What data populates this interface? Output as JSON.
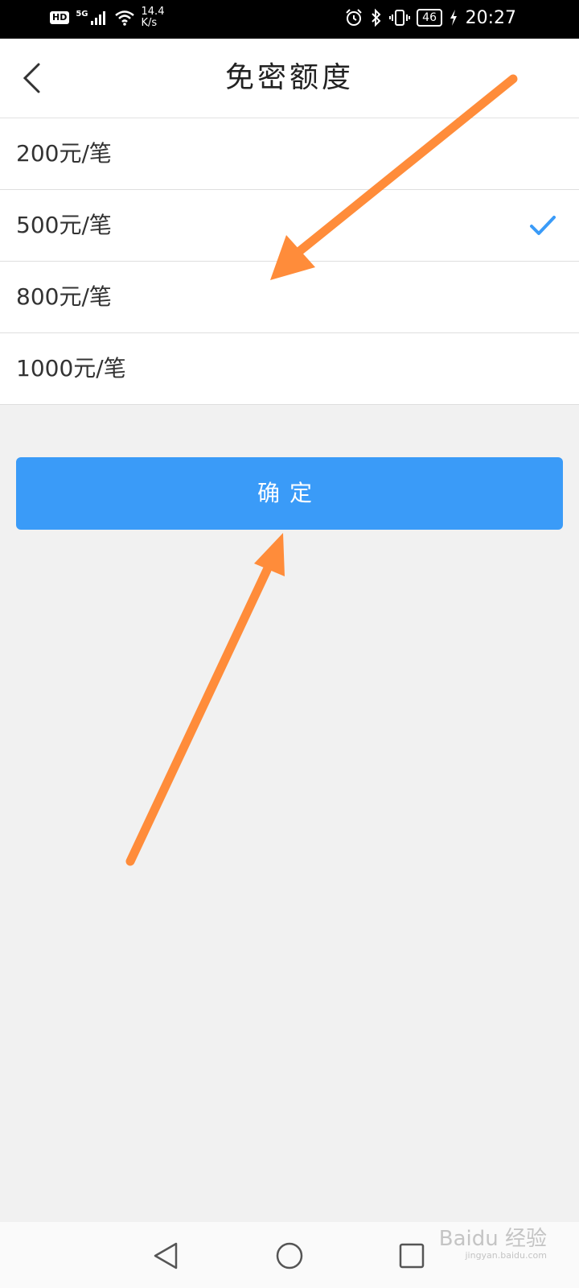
{
  "status_bar": {
    "hd": "HD",
    "network": "5G",
    "speed_value": "14.4",
    "speed_unit": "K/s",
    "battery": "46",
    "time": "20:27"
  },
  "header": {
    "title": "免密额度"
  },
  "options": [
    {
      "label": "200元/笔",
      "selected": false
    },
    {
      "label": "500元/笔",
      "selected": true
    },
    {
      "label": "800元/笔",
      "selected": false
    },
    {
      "label": "1000元/笔",
      "selected": false
    }
  ],
  "confirm_label": "确定",
  "watermark": {
    "text": "Baidu 经验",
    "url": "jingyan.baidu.com"
  },
  "colors": {
    "accent": "#3a9bf8",
    "annotation_arrow": "#ff8c3a",
    "background": "#f1f1f1"
  }
}
